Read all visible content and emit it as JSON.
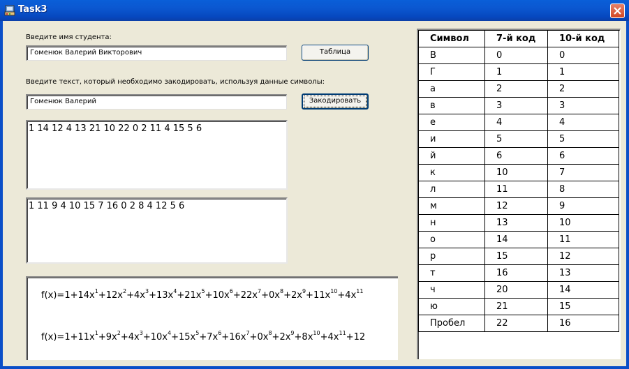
{
  "window": {
    "title": "Task3"
  },
  "form": {
    "student_label": "Введите имя студента:",
    "student_value": "Гоменюк Валерий Викторович",
    "table_button": "Таблица",
    "text_label": "Введите текст, который необходимо закодировать, используя данные символы:",
    "text_value": "Гоменюк Валерий",
    "encode_button": "Закодировать",
    "code7": "1 14 12 4 13 21 10 22 0 2 11 4 15 5 6",
    "code10": "1 11 9 4 10 15 7 16 0 2 8 4 12 5 6"
  },
  "formulas": {
    "poly7": [
      {
        "coef": "1"
      },
      {
        "coef": "14",
        "exp": "1"
      },
      {
        "coef": "12",
        "exp": "2"
      },
      {
        "coef": "4",
        "exp": "3"
      },
      {
        "coef": "13",
        "exp": "4"
      },
      {
        "coef": "21",
        "exp": "5"
      },
      {
        "coef": "10",
        "exp": "6"
      },
      {
        "coef": "22",
        "exp": "7"
      },
      {
        "coef": "0",
        "exp": "8"
      },
      {
        "coef": "2",
        "exp": "9"
      },
      {
        "coef": "11",
        "exp": "10"
      },
      {
        "coef": "4",
        "exp": "11"
      }
    ],
    "poly10": [
      {
        "coef": "1"
      },
      {
        "coef": "11",
        "exp": "1"
      },
      {
        "coef": "9",
        "exp": "2"
      },
      {
        "coef": "4",
        "exp": "3"
      },
      {
        "coef": "10",
        "exp": "4"
      },
      {
        "coef": "15",
        "exp": "5"
      },
      {
        "coef": "7",
        "exp": "6"
      },
      {
        "coef": "16",
        "exp": "7"
      },
      {
        "coef": "0",
        "exp": "8"
      },
      {
        "coef": "2",
        "exp": "9"
      },
      {
        "coef": "8",
        "exp": "10"
      },
      {
        "coef": "4",
        "exp": "11"
      },
      {
        "coef": "12",
        "exp": ""
      }
    ]
  },
  "table": {
    "headers": [
      "Символ",
      "7-й код",
      "10-й код"
    ],
    "rows": [
      [
        "В",
        "0",
        "0"
      ],
      [
        "Г",
        "1",
        "1"
      ],
      [
        "а",
        "2",
        "2"
      ],
      [
        "в",
        "3",
        "3"
      ],
      [
        "е",
        "4",
        "4"
      ],
      [
        "и",
        "5",
        "5"
      ],
      [
        "й",
        "6",
        "6"
      ],
      [
        "к",
        "10",
        "7"
      ],
      [
        "л",
        "11",
        "8"
      ],
      [
        "м",
        "12",
        "9"
      ],
      [
        "н",
        "13",
        "10"
      ],
      [
        "о",
        "14",
        "11"
      ],
      [
        "р",
        "15",
        "12"
      ],
      [
        "т",
        "16",
        "13"
      ],
      [
        "ч",
        "20",
        "14"
      ],
      [
        "ю",
        "21",
        "15"
      ],
      [
        "Пробел",
        "22",
        "16"
      ]
    ]
  }
}
